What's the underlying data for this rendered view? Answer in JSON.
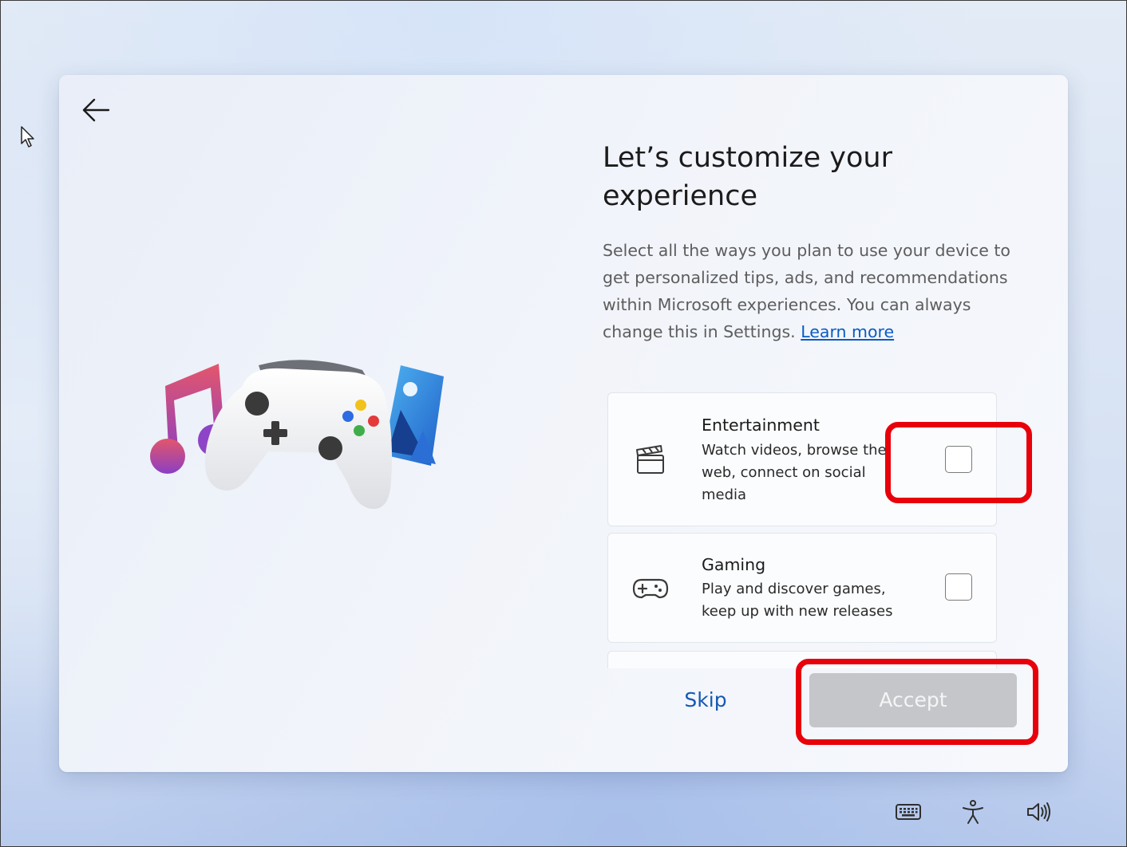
{
  "page": {
    "title": "Let’s customize your experience",
    "description": "Select all the ways you plan to use your device to get personalized tips, ads, and recommendations within Microsoft experiences. You can always change this in Settings.",
    "learn_more": "Learn more"
  },
  "hero": {
    "icons": [
      "music-note-icon",
      "game-controller-icon",
      "photo-icon"
    ]
  },
  "options": [
    {
      "name": "Entertainment",
      "lines": [
        "Watch videos, browse the",
        "web, connect on social",
        "media"
      ],
      "icon": "clapperboard-icon",
      "checked": false
    },
    {
      "name": "Gaming",
      "lines": [
        "Play and discover games,",
        "keep up with new releases"
      ],
      "icon": "gamepad-icon",
      "checked": false
    }
  ],
  "buttons": {
    "skip": "Skip",
    "accept": "Accept",
    "accept_enabled": false
  },
  "taskbar": {
    "icons": [
      "keyboard-icon",
      "accessibility-icon",
      "volume-icon"
    ]
  },
  "annotations": {
    "highlight_color": "#e8000b"
  },
  "colors": {
    "link": "#0a5bc4",
    "skip": "#1559b3",
    "accept_disabled_bg": "#c4c6c9"
  }
}
